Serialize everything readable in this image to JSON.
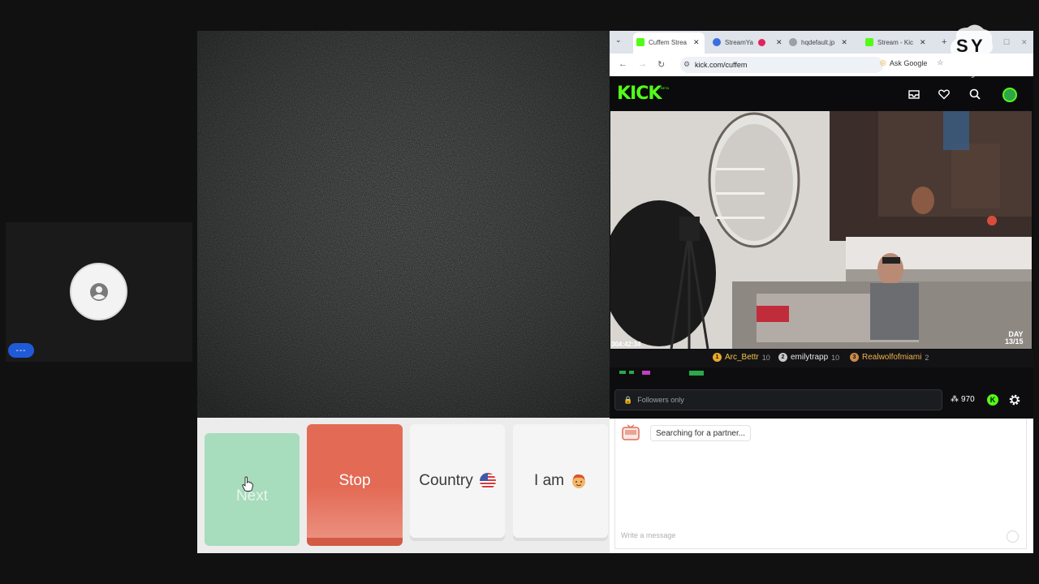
{
  "participant": {
    "name_tag": "---",
    "avatar_icon": "user-circle-icon"
  },
  "controls": {
    "next_label": "Next",
    "stop_label": "Stop",
    "country_label": "Country",
    "iam_label": "I am"
  },
  "browser": {
    "tabs": [
      {
        "title": "Cuffem Strea",
        "icon": "kick-favicon"
      },
      {
        "title": "StreamYa",
        "icon": "streamyard-favicon"
      },
      {
        "title": "hqdefault.jp",
        "icon": "image-favicon"
      },
      {
        "title": "Stream - Kic",
        "icon": "kick-favicon"
      }
    ],
    "url": "kick.com/cuffem",
    "ask_google": "Ask Google"
  },
  "kick": {
    "logo": "KICK",
    "beta": "BETA",
    "timestamp": "304:42:34",
    "day_label": "DAY",
    "day_value": "13/15",
    "leaderboard": [
      {
        "rank": "1",
        "name": "Arc_Bettr",
        "count": "10",
        "color": "#e8a92b",
        "name_color": "#f4c644"
      },
      {
        "rank": "2",
        "name": "emilytrapp",
        "count": "10",
        "color": "#c8c8c8",
        "name_color": "#e6e6e6"
      },
      {
        "rank": "3",
        "name": "Realwolfofmiami",
        "count": "2",
        "color": "#c98a4a",
        "name_color": "#f0b24a"
      }
    ],
    "followers_only": "Followers only",
    "viewers": "970"
  },
  "watermark": {
    "text": "streamyard"
  },
  "chat": {
    "status": "Searching for a partner...",
    "placeholder": "Write a message"
  },
  "colors": {
    "kick_green": "#53fc18",
    "next_green": "#a7dcbd",
    "stop_red": "#e36a55"
  }
}
